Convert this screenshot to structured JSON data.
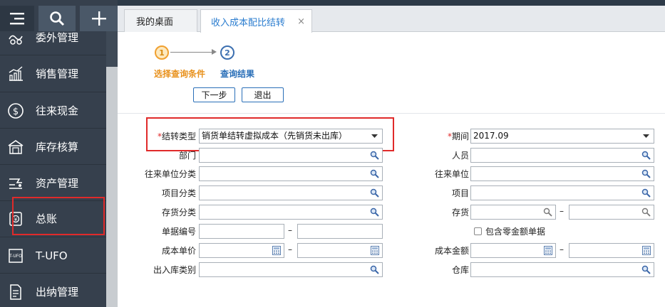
{
  "toolbar": {
    "menu_icon": "hamburger-icon",
    "search_icon": "search-icon",
    "add_icon": "plus-icon"
  },
  "sidebar": {
    "items": [
      {
        "label": "委外管理",
        "icon": "outsourcing-icon"
      },
      {
        "label": "销售管理",
        "icon": "sales-chart-icon"
      },
      {
        "label": "往来现金",
        "icon": "dollar-circle-icon"
      },
      {
        "label": "库存核算",
        "icon": "warehouse-icon"
      },
      {
        "label": "资产管理",
        "icon": "asset-icon"
      },
      {
        "label": "总账",
        "icon": "ledger-icon"
      },
      {
        "label": "T-UFO",
        "icon": "tufo-icon"
      },
      {
        "label": "出纳管理",
        "icon": "cashier-icon"
      }
    ]
  },
  "tabs": [
    {
      "label": "我的桌面"
    },
    {
      "label": "收入成本配比结转",
      "close": "×"
    }
  ],
  "steps": [
    {
      "num": "1",
      "label": "选择查询条件"
    },
    {
      "num": "2",
      "label": "查询结果"
    }
  ],
  "buttons": {
    "next": "下一步",
    "exit": "退出"
  },
  "form": {
    "transfer_type_label": "结转类型",
    "required_mark": "*",
    "transfer_type_value": "销货单结转虚拟成本（先销货未出库）",
    "period_label": "期间",
    "period_value": "2017.09",
    "dept_label": "部门",
    "person_label": "人员",
    "partner_cat_label": "往来单位分类",
    "partner_label": "往来单位",
    "project_cat_label": "项目分类",
    "project_label": "项目",
    "stock_cat_label": "存货分类",
    "stock_label": "存货",
    "doc_no_label": "单据编号",
    "zero_amount_label": "包含零金额单据",
    "unit_cost_label": "成本单价",
    "cost_amount_label": "成本金额",
    "io_type_label": "出入库类别",
    "warehouse_label": "仓库",
    "range_dash": "–"
  },
  "colors": {
    "sidebar_bg": "#36404d",
    "accent_blue": "#2a7ccf",
    "step_orange": "#e8911c",
    "highlight_red": "#e02a2a"
  }
}
